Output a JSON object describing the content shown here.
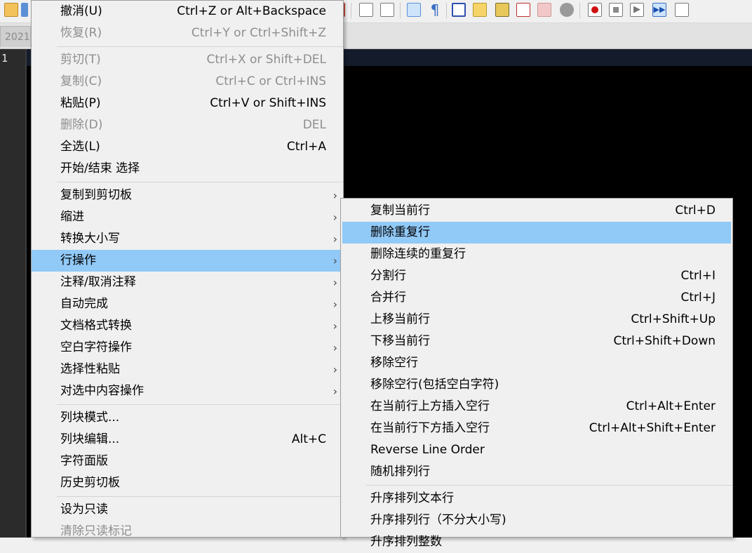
{
  "tab": {
    "label": "2021"
  },
  "editor": {
    "line_number": "1"
  },
  "main_menu": {
    "undo": {
      "label": "撤消(U)",
      "shortcut": "Ctrl+Z or Alt+Backspace"
    },
    "redo": {
      "label": "恢复(R)",
      "shortcut": "Ctrl+Y or Ctrl+Shift+Z"
    },
    "cut": {
      "label": "剪切(T)",
      "shortcut": "Ctrl+X or Shift+DEL"
    },
    "copy": {
      "label": "复制(C)",
      "shortcut": "Ctrl+C or Ctrl+INS"
    },
    "paste": {
      "label": "粘贴(P)",
      "shortcut": "Ctrl+V or Shift+INS"
    },
    "delete": {
      "label": "删除(D)",
      "shortcut": "DEL"
    },
    "select_all": {
      "label": "全选(L)",
      "shortcut": "Ctrl+A"
    },
    "begin_end_select": {
      "label": "开始/结束 选择"
    },
    "copy_to_clipboard": {
      "label": "复制到剪切板"
    },
    "indent": {
      "label": "缩进"
    },
    "convert_case": {
      "label": "转换大小写"
    },
    "line_operations": {
      "label": "行操作"
    },
    "comment": {
      "label": "注释/取消注释"
    },
    "auto_complete": {
      "label": "自动完成"
    },
    "eol_conversion": {
      "label": "文档格式转换"
    },
    "blank_operations": {
      "label": "空白字符操作"
    },
    "paste_special": {
      "label": "选择性粘贴"
    },
    "on_selection": {
      "label": "对选中内容操作"
    },
    "column_mode": {
      "label": "列块模式..."
    },
    "column_editor": {
      "label": "列块编辑...",
      "shortcut": "Alt+C"
    },
    "char_panel": {
      "label": "字符面版"
    },
    "clipboard_history": {
      "label": "历史剪切板"
    },
    "set_read_only": {
      "label": "设为只读"
    },
    "clear_read_only": {
      "label": "清除只读标记"
    },
    "submenu_arrow": "›"
  },
  "sub_menu": {
    "duplicate_line": {
      "label": "复制当前行",
      "shortcut": "Ctrl+D"
    },
    "remove_duplicate": {
      "label": "删除重复行"
    },
    "remove_consecutive_duplicate": {
      "label": "删除连续的重复行"
    },
    "split_lines": {
      "label": "分割行",
      "shortcut": "Ctrl+I"
    },
    "join_lines": {
      "label": "合并行",
      "shortcut": "Ctrl+J"
    },
    "move_up": {
      "label": "上移当前行",
      "shortcut": "Ctrl+Shift+Up"
    },
    "move_down": {
      "label": "下移当前行",
      "shortcut": "Ctrl+Shift+Down"
    },
    "remove_empty": {
      "label": "移除空行"
    },
    "remove_empty_blank": {
      "label": "移除空行(包括空白字符)"
    },
    "insert_above": {
      "label": "在当前行上方插入空行",
      "shortcut": "Ctrl+Alt+Enter"
    },
    "insert_below": {
      "label": "在当前行下方插入空行",
      "shortcut": "Ctrl+Alt+Shift+Enter"
    },
    "reverse_order": {
      "label": "Reverse Line Order"
    },
    "randomize": {
      "label": "随机排列行"
    },
    "sort_asc": {
      "label": "升序排列文本行"
    },
    "sort_asc_ci": {
      "label": "升序排列行（不分大小写)"
    },
    "sort_asc_int": {
      "label": "升序排列整数"
    }
  },
  "colors": {
    "highlight": "#91c9f7",
    "editor_bg": "#000000",
    "menu_bg": "#f0f0f0"
  }
}
